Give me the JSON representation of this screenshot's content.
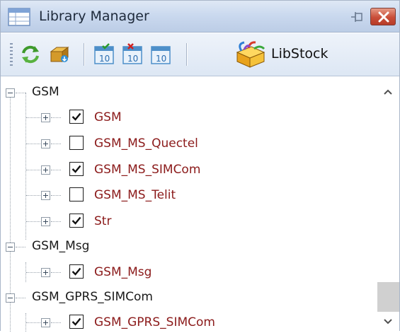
{
  "window": {
    "title": "Library Manager"
  },
  "toolbar": {
    "buttons": [
      {
        "name": "refresh",
        "icon": "refresh-icon"
      },
      {
        "name": "install",
        "icon": "package-install-icon"
      },
      {
        "name": "check-all",
        "icon": "calendar-check-icon"
      },
      {
        "name": "uncheck-all",
        "icon": "calendar-x-icon"
      },
      {
        "name": "clear",
        "icon": "calendar-icon"
      }
    ],
    "libstock_label": "LibStock"
  },
  "tree": {
    "nodes": [
      {
        "label": "GSM",
        "level": 0,
        "expanded": true
      },
      {
        "label": "GSM",
        "level": 1,
        "checked": true
      },
      {
        "label": "GSM_MS_Quectel",
        "level": 1,
        "checked": false
      },
      {
        "label": "GSM_MS_SIMCom",
        "level": 1,
        "checked": true
      },
      {
        "label": "GSM_MS_Telit",
        "level": 1,
        "checked": false
      },
      {
        "label": "Str",
        "level": 1,
        "checked": true
      },
      {
        "label": "GSM_Msg",
        "level": 0,
        "expanded": true
      },
      {
        "label": "GSM_Msg",
        "level": 1,
        "checked": true
      },
      {
        "label": "GSM_GPRS_SIMCom",
        "level": 0,
        "expanded": true
      },
      {
        "label": "GSM_GPRS_SIMCom",
        "level": 1,
        "checked": true
      }
    ]
  },
  "colors": {
    "group_text": "#1a1a1a",
    "lib_text": "#8b1a1a",
    "close_button": "#c94e39",
    "titlebar": "#c9d8ee"
  }
}
